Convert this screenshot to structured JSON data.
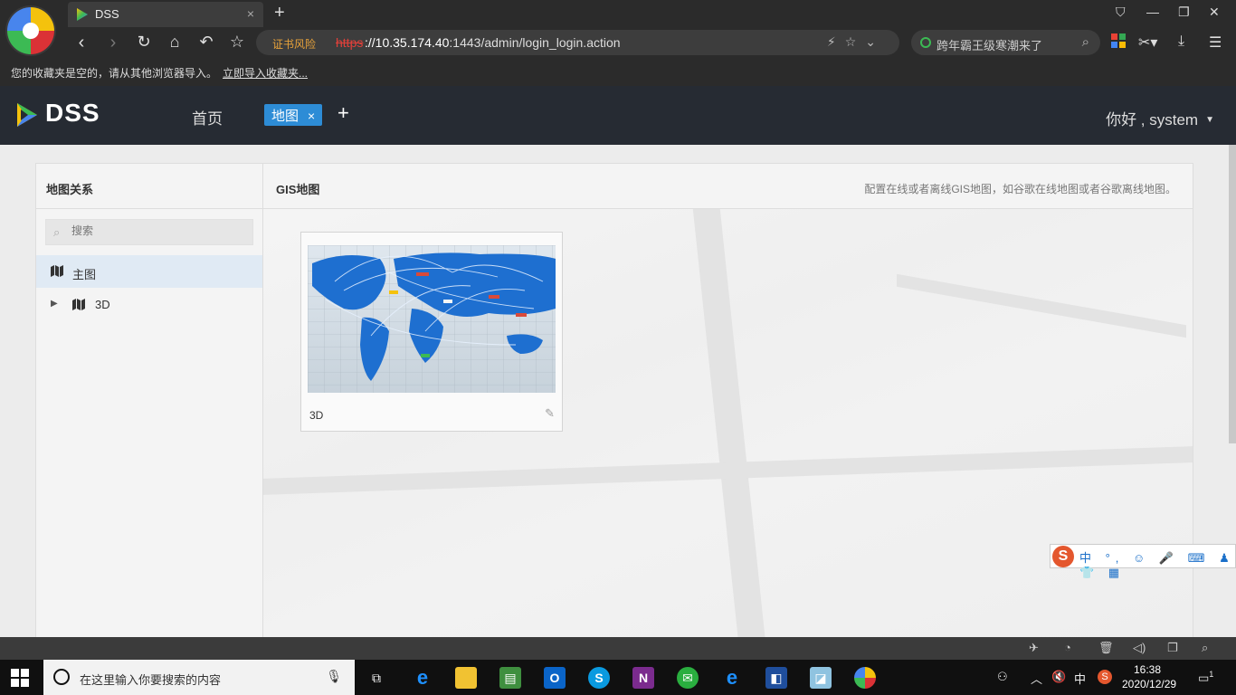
{
  "browser": {
    "tab_title": "DSS",
    "tab_close": "×",
    "new_tab": "+",
    "window_controls": [
      "☐",
      "—",
      "❐",
      "✕"
    ],
    "address": {
      "warning": "证书风险",
      "scheme": "https",
      "url_host": "://10.35.174.40",
      "url_rest": ":1443/admin/login_login.action"
    },
    "search_placeholder": "跨年霸王级寒潮来了",
    "bookmark_bar": {
      "message": "您的收藏夹是空的，请从其他浏览器导入。",
      "import_link": "立即导入收藏夹..."
    }
  },
  "app": {
    "logo_text": "DSS",
    "nav": {
      "home": "首页",
      "active_tab": "地图",
      "active_tab_close": "×",
      "add": "+"
    },
    "user_greeting": "你好 , system",
    "user_caret": "▼"
  },
  "left_panel": {
    "title": "地图关系",
    "search_placeholder": "搜索",
    "tree": [
      {
        "label": "主图",
        "selected": true,
        "expandable": false
      },
      {
        "label": "3D",
        "selected": false,
        "expandable": true
      }
    ]
  },
  "main_panel": {
    "title": "GIS地图",
    "description": "配置在线或者离线GIS地图，如谷歌在线地图或者谷歌离线地图。",
    "cards": [
      {
        "caption": "3D"
      }
    ]
  },
  "ime": {
    "logo": "S",
    "items": "中 °, ☺ 🎤 ⌨ ♟ 👕 ▦"
  },
  "taskbar": {
    "search_placeholder": "在这里输入你要搜索的内容",
    "tray": {
      "lang": "中",
      "time": "16:38",
      "date": "2020/12/29",
      "notification_count": "1"
    }
  },
  "colors": {
    "accent": "#2d8cd6",
    "header_bg": "#262b33",
    "browser_bg": "#2b2b2b"
  }
}
